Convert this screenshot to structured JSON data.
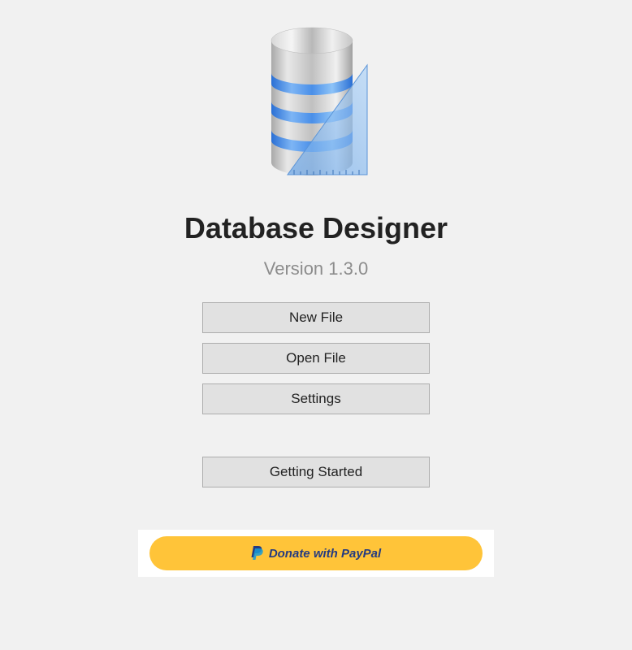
{
  "app": {
    "title": "Database Designer",
    "version_label": "Version 1.3.0"
  },
  "buttons": {
    "new_file": "New File",
    "open_file": "Open File",
    "settings": "Settings",
    "getting_started": "Getting Started"
  },
  "donate": {
    "label": "Donate with PayPal"
  },
  "icons": {
    "logo": "database-designer-icon",
    "paypal": "paypal-icon"
  }
}
